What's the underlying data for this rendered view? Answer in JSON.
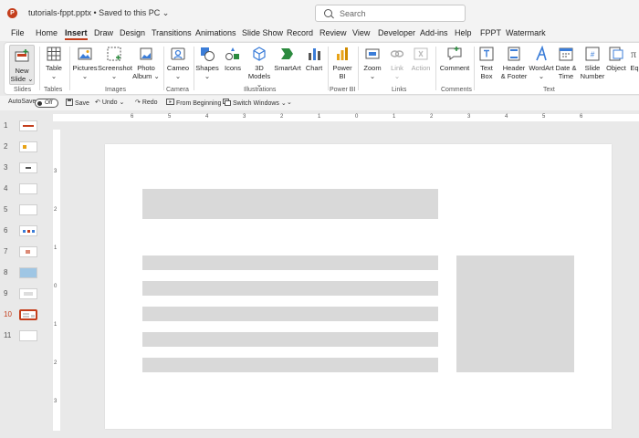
{
  "titlebar": {
    "app_icon": "powerpoint-logo-icon",
    "app_letter": "P",
    "doc_title": "tutorials-fppt.pptx • Saved to this PC ⌄",
    "search_placeholder": "Search"
  },
  "menu": {
    "tabs": [
      "File",
      "Home",
      "Insert",
      "Draw",
      "Design",
      "Transitions",
      "Animations",
      "Slide Show",
      "Record",
      "Review",
      "View",
      "Developer",
      "Add-ins",
      "Help",
      "FPPT",
      "Watermark"
    ],
    "active": "Insert"
  },
  "ribbon": {
    "slides": {
      "new_slide_line1": "New",
      "new_slide_line2": "Slide ⌄",
      "group": "Slides"
    },
    "tables": {
      "table_line1": "Table",
      "table_line2": "⌄",
      "group": "Tables"
    },
    "images": {
      "pictures_line1": "Pictures",
      "pictures_line2": "⌄",
      "screenshot_line1": "Screenshot",
      "screenshot_line2": "⌄",
      "photo_album_line1": "Photo",
      "photo_album_line2": "Album ⌄",
      "group": "Images"
    },
    "camera": {
      "cameo_line1": "Cameo",
      "cameo_line2": "⌄",
      "group": "Camera"
    },
    "illustrations": {
      "shapes_line1": "Shapes",
      "shapes_line2": "⌄",
      "icons": "Icons",
      "models_line1": "3D",
      "models_line2": "Models ⌄",
      "smartart": "SmartArt",
      "chart": "Chart",
      "group": "Illustrations"
    },
    "powerbi": {
      "line1": "Power",
      "line2": "BI",
      "group": "Power BI"
    },
    "links": {
      "zoom_line1": "Zoom",
      "zoom_line2": "⌄",
      "link_line1": "Link",
      "link_line2": "⌄",
      "action": "Action",
      "group": "Links"
    },
    "comments": {
      "comment": "Comment",
      "group": "Comments"
    },
    "text": {
      "textbox_line1": "Text",
      "textbox_line2": "Box",
      "header_line1": "Header",
      "header_line2": "& Footer",
      "wordart_line1": "WordArt",
      "wordart_line2": "⌄",
      "datetime_line1": "Date &",
      "datetime_line2": "Time",
      "slidenum_line1": "Slide",
      "slidenum_line2": "Number",
      "object": "Object",
      "group": "Text"
    },
    "equation": "Eq"
  },
  "qat": {
    "autosave": "AutoSave",
    "autosave_state": "Off",
    "save": "Save",
    "undo": "Undo",
    "undo_caret": "⌄",
    "redo": "Redo",
    "from_beginning": "From Beginning",
    "switch_windows": "Switch Windows ⌄",
    "customize": "⌄"
  },
  "thumbnails": {
    "numbers": [
      "1",
      "2",
      "3",
      "4",
      "5",
      "6",
      "7",
      "8",
      "9",
      "10",
      "11"
    ],
    "selected": "10"
  },
  "rulers": {
    "horizontal": [
      "6",
      "5",
      "4",
      "3",
      "2",
      "1",
      "0",
      "1",
      "2",
      "3",
      "4",
      "5",
      "6"
    ],
    "vertical": [
      "3",
      "2",
      "1",
      "0",
      "1",
      "2",
      "3"
    ]
  },
  "colors": {
    "accent": "#c43e1c",
    "placeholder": "#d9d9d9"
  }
}
